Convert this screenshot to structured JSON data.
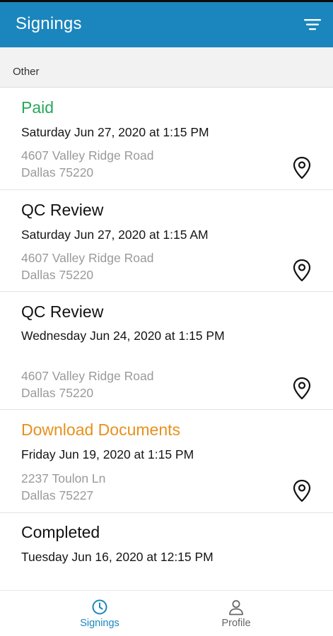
{
  "header": {
    "title": "Signings",
    "filter_icon": "filter-icon"
  },
  "section": {
    "label": "Other"
  },
  "colors": {
    "header_bg": "#1b86bd",
    "paid": "#27a85a",
    "download": "#e8901c",
    "default_status": "#111111",
    "nav_active": "#1b86bd",
    "nav_inactive": "#666666"
  },
  "signings": [
    {
      "status": "Paid",
      "status_color": "#27a85a",
      "date": "Saturday Jun 27, 2020 at 1:15 PM",
      "address_line1": "4607 Valley Ridge Road",
      "address_line2": "Dallas 75220",
      "icon": "location-pin-icon"
    },
    {
      "status": "QC Review",
      "status_color": "#111111",
      "date": "Saturday Jun 27, 2020 at 1:15 AM",
      "address_line1": "4607 Valley Ridge Road",
      "address_line2": "Dallas 75220",
      "icon": "location-pin-icon"
    },
    {
      "status": "QC Review",
      "status_color": "#111111",
      "date": "Wednesday Jun 24, 2020 at 1:15 PM",
      "address_line1": "4607 Valley Ridge Road",
      "address_line2": "Dallas 75220",
      "icon": "location-pin-icon"
    },
    {
      "status": "Download Documents",
      "status_color": "#e8901c",
      "date": "Friday Jun 19, 2020 at 1:15 PM",
      "address_line1": "2237 Toulon Ln",
      "address_line2": "Dallas 75227",
      "icon": "location-pin-icon"
    },
    {
      "status": "Completed",
      "status_color": "#111111",
      "date": "Tuesday Jun 16, 2020 at 12:15 PM",
      "address_line1": "",
      "address_line2": "",
      "icon": "location-pin-icon"
    }
  ],
  "bottom_nav": {
    "items": [
      {
        "label": "Signings",
        "icon": "clock-icon",
        "active": true
      },
      {
        "label": "Profile",
        "icon": "person-icon",
        "active": false
      }
    ]
  }
}
